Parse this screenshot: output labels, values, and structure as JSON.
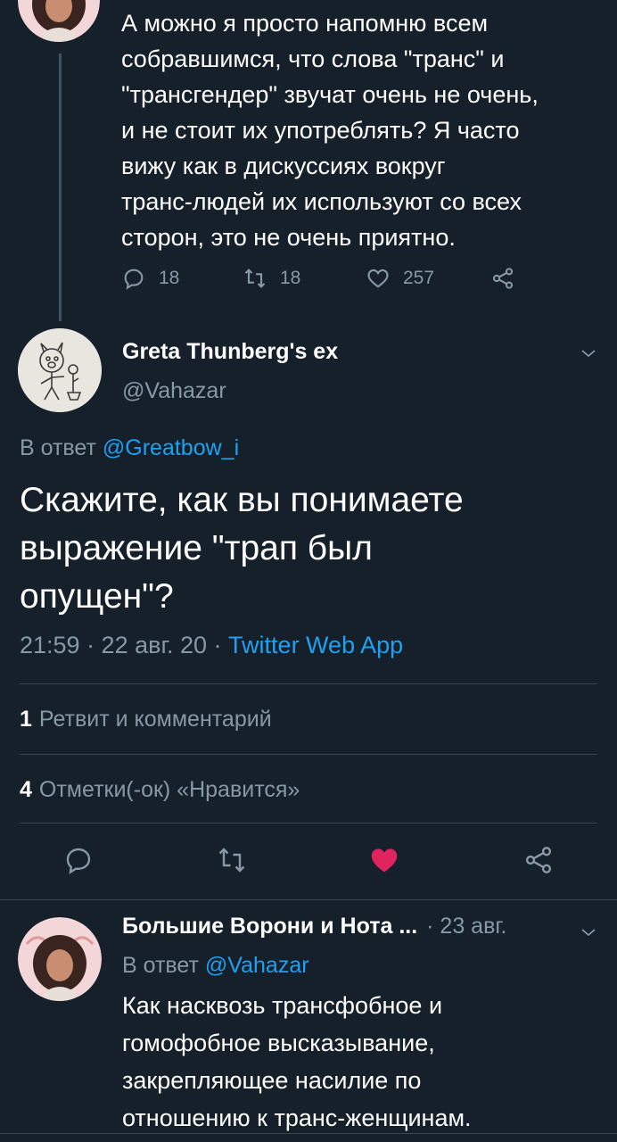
{
  "parent_tweet": {
    "text": "А можно я просто напомню всем\nсобравшимся, что слова \"транс\" и\n\"трансгендер\" звучат очень не очень,\nи не стоит их употреблять? Я часто\nвижу как в дискуссиях вокруг\nтранс-людей их используют со всех\nсторон, это не очень приятно.",
    "replies": "18",
    "retweets": "18",
    "likes": "257",
    "icons": [
      "reply-icon",
      "retweet-icon",
      "like-icon",
      "share-icon"
    ]
  },
  "main_tweet": {
    "author_name": "Greta Thunberg's ex",
    "author_handle": "@Vahazar",
    "reply_prefix": "В ответ ",
    "reply_mention": "@Greatbow_i",
    "text": "Скажите, как вы понимаете\nвыражение \"трап был\nопущен\"?",
    "time_date": "21:59 · 22 авг. 20 · ",
    "source": "Twitter Web App",
    "retweet_count": "1",
    "retweet_label": "Ретвит и комментарий",
    "like_count": "4",
    "like_label": "Отметки(-ок) «Нравится»",
    "liked": true,
    "like_color": "#e0245e"
  },
  "reply_tweet": {
    "author_name": "Большие Ворони и Нота ...",
    "date": "· 23 авг.",
    "reply_prefix": "В ответ ",
    "reply_mention": "@Vahazar",
    "text": "Как насквозь трансфобное и\nгомофобное высказывание,\nзакрепляющее насилие по\nотношению к транс-женщинам."
  },
  "colors": {
    "background": "#15202b",
    "secondary_text": "#8899a6",
    "link": "#1da1f2",
    "divider": "#38444d"
  }
}
